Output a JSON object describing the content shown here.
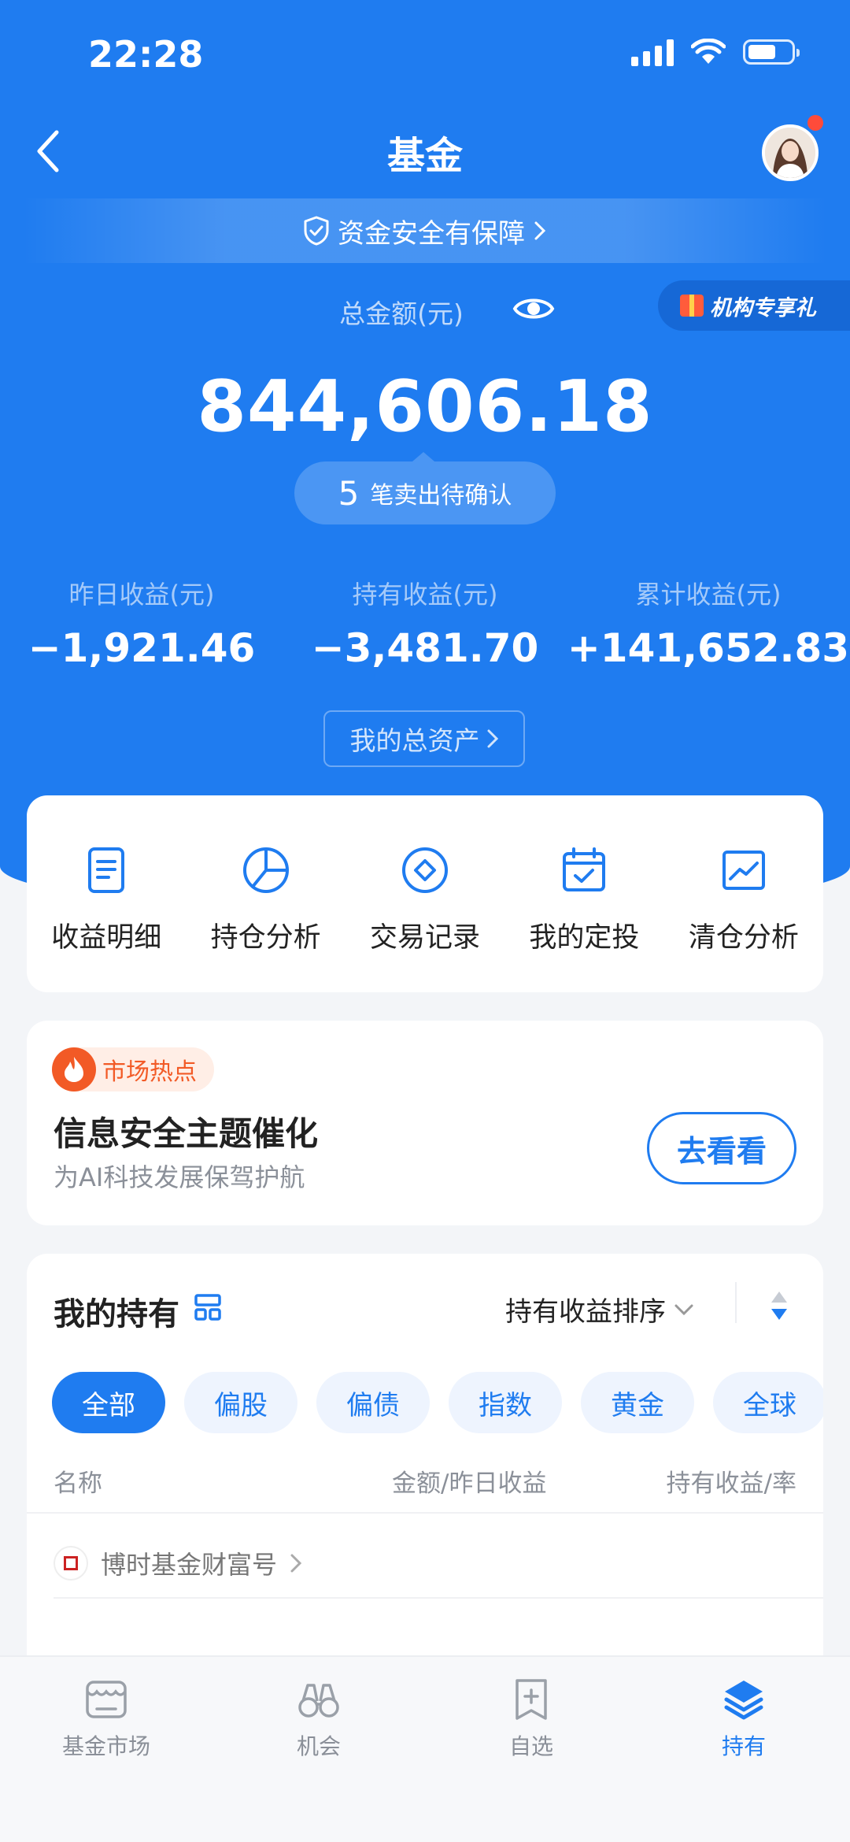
{
  "status_bar": {
    "time": "22:28"
  },
  "nav": {
    "title": "基金"
  },
  "safety": {
    "text": "资金安全有保障"
  },
  "promo": {
    "label": "机构专享礼"
  },
  "summary": {
    "total_label": "总金额(元)",
    "total_amount": "844,606.18",
    "pending_count": "5",
    "pending_text": "笔卖出待确认",
    "stats": [
      {
        "label": "昨日收益(元)",
        "value": "−1,921.46"
      },
      {
        "label": "持有收益(元)",
        "value": "−3,481.70"
      },
      {
        "label": "累计收益(元)",
        "value": "+141,652.83"
      }
    ],
    "assets_button": "我的总资产"
  },
  "quick_actions": [
    {
      "label": "收益明细",
      "icon": "document-icon"
    },
    {
      "label": "持仓分析",
      "icon": "pie-chart-icon"
    },
    {
      "label": "交易记录",
      "icon": "diamond-circle-icon"
    },
    {
      "label": "我的定投",
      "icon": "calendar-check-icon"
    },
    {
      "label": "清仓分析",
      "icon": "trend-chart-icon"
    }
  ],
  "market_hot": {
    "tag": "市场热点",
    "title": "信息安全主题催化",
    "subtitle": "为AI科技发展保驾护航",
    "button": "去看看"
  },
  "holdings": {
    "title": "我的持有",
    "sort_label": "持有收益排序",
    "filters": [
      "全部",
      "偏股",
      "偏债",
      "指数",
      "黄金",
      "全球"
    ],
    "active_filter": 0,
    "columns": {
      "name": "名称",
      "amount": "金额/昨日收益",
      "profit": "持有收益/率"
    },
    "company": "博时基金财富号"
  },
  "tabbar": [
    {
      "label": "基金市场",
      "icon": "market-icon"
    },
    {
      "label": "机会",
      "icon": "binoculars-icon"
    },
    {
      "label": "自选",
      "icon": "bookmark-add-icon"
    },
    {
      "label": "持有",
      "icon": "layers-icon"
    }
  ],
  "colors": {
    "brand_blue": "#1f7cf0",
    "hot_orange": "#f25a26",
    "alert_red": "#ff4b3a"
  }
}
